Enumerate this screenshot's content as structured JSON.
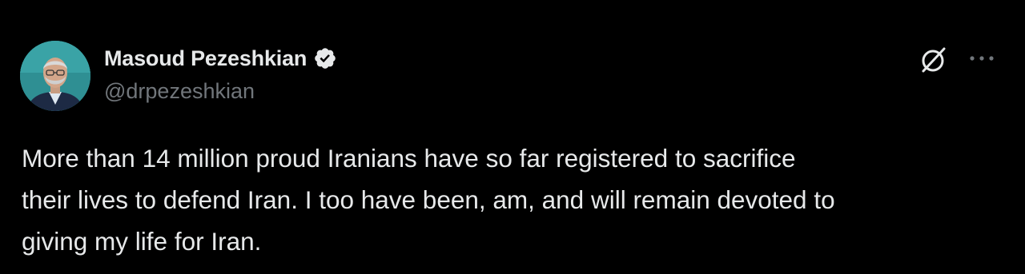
{
  "author": {
    "display_name": "Masoud Pezeshkian",
    "handle": "@drpezeshkian",
    "verified_icon": "verified-badge-icon",
    "verified_color": "#e7e9ea"
  },
  "actions": {
    "grok_icon": "grok-icon",
    "more_icon": "more-options-icon"
  },
  "tweet": {
    "text": "More than 14 million proud Iranians have so far registered to sacrifice\ntheir lives to defend Iran. I too have been, am, and will remain devoted to\ngiving my life for Iran."
  },
  "colors": {
    "background": "#000000",
    "primary_text": "#e7e9ea",
    "secondary_text": "#71767b",
    "avatar_bg": "#2f8f93"
  }
}
